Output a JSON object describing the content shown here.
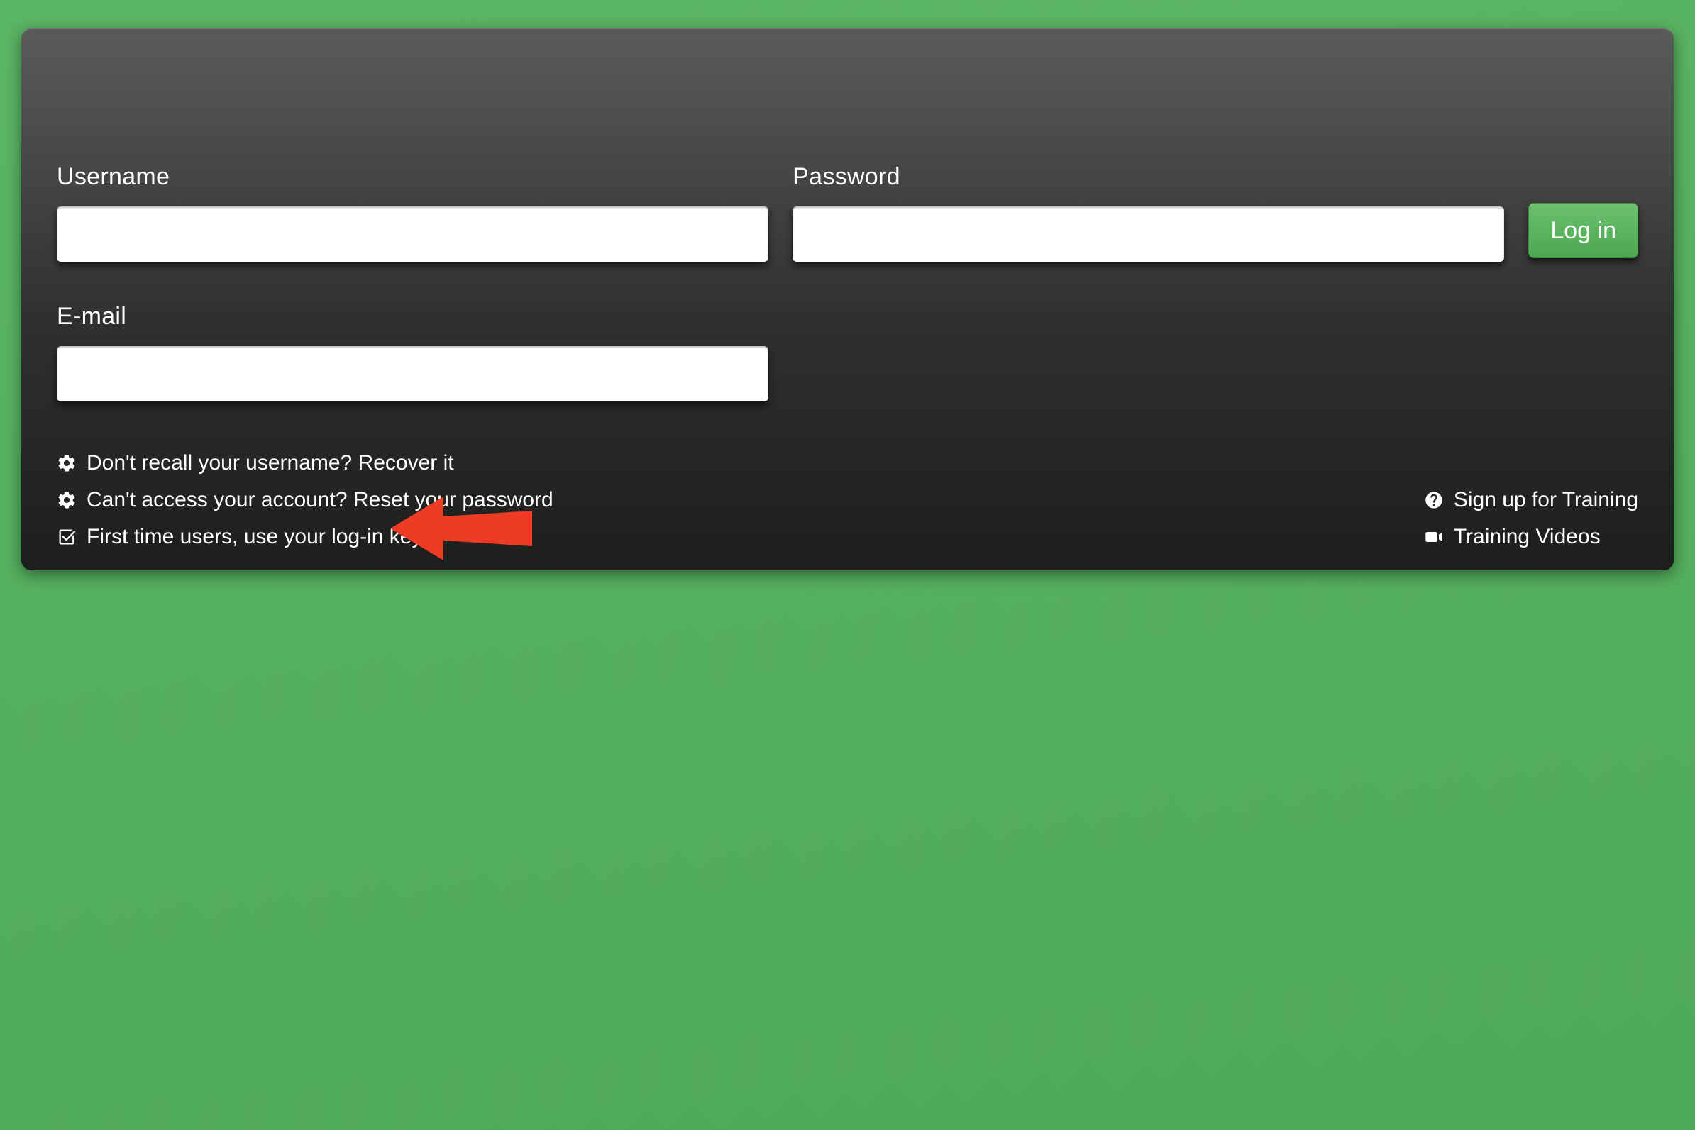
{
  "fields": {
    "username_label": "Username",
    "password_label": "Password",
    "email_label": "E-mail",
    "username_value": "",
    "password_value": "",
    "email_value": ""
  },
  "buttons": {
    "login_label": "Log in"
  },
  "links": {
    "recover_username": "Don't recall your username? Recover it",
    "reset_password": "Can't access your account? Reset your password",
    "first_time_key": "First time users, use your log-in key",
    "signup_training": "Sign up for Training",
    "training_videos": "Training Videos"
  },
  "colors": {
    "accent": "#4ca850",
    "panel_dark": "#1e1e1e",
    "annotation_arrow": "#ee3b24"
  }
}
